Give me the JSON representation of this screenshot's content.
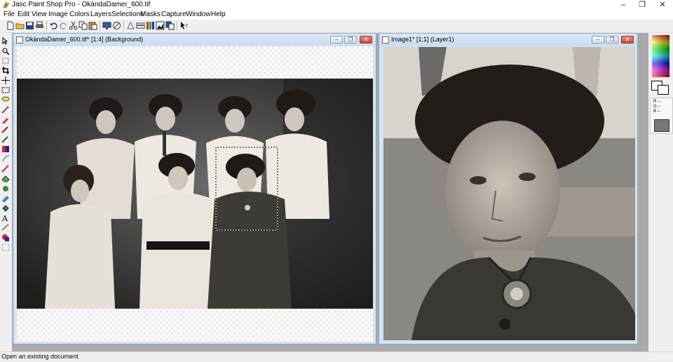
{
  "window": {
    "title": "Jasc Paint Shop Pro - OkändaDamer_600.tif",
    "minimize_glyph": "‒",
    "maximize_glyph": "❐",
    "close_glyph": "✕"
  },
  "menu": [
    "File",
    "Edit",
    "View",
    "Image",
    "Colors",
    "Layers",
    "Selections",
    "Masks",
    "Capture",
    "Window",
    "Help"
  ],
  "documents": [
    {
      "title": "OkändaDamer_600.tif* [1:4] (Background)"
    },
    {
      "title": "Image1* [1:1] (Layer1)"
    }
  ],
  "palette": {
    "rgb_readout": [
      "R --",
      "G --",
      "B --"
    ]
  },
  "statusbar": {
    "text": "Open an existing document"
  },
  "colors": {
    "workspace": "#aaaaaa",
    "doc_frame": "#d6e3f1",
    "close_red": "#c9463a"
  }
}
